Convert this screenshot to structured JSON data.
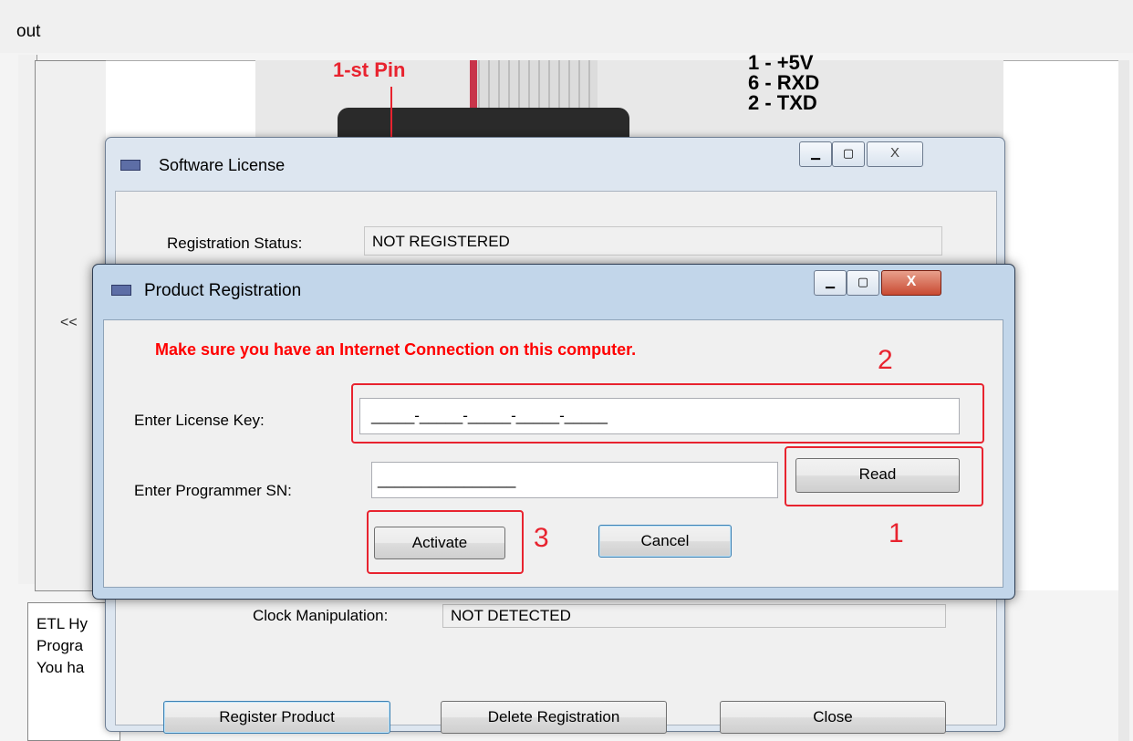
{
  "background_app": {
    "menu_text": "out",
    "image_labels": {
      "pin": "1-st Pin",
      "pinout": "1 - +5V\n6 - RXD\n2 - TXD"
    },
    "collapse_button": "<<",
    "log_lines": [
      "ETL Hy",
      "Progra",
      "You ha"
    ]
  },
  "license_window": {
    "title": "Software License",
    "registration_status_label": "Registration Status:",
    "registration_status_value": "NOT REGISTERED",
    "clock_label": "Clock Manipulation:",
    "clock_value": "NOT DETECTED",
    "register_button": "Register Product",
    "delete_button": "Delete Registration",
    "close_button": "Close",
    "caption": {
      "minimize": "▁",
      "maximize": "▢",
      "close": "X"
    }
  },
  "registration_dialog": {
    "title": "Product Registration",
    "warning": "Make sure you have an Internet Connection on this computer.",
    "license_key_label": "Enter License Key:",
    "license_key_value": "_____-_____-_____-_____-_____",
    "programmer_sn_label": "Enter Programmer SN:",
    "programmer_sn_value": "________________",
    "read_button": "Read",
    "activate_button": "Activate",
    "cancel_button": "Cancel",
    "caption": {
      "minimize": "▁",
      "maximize": "▢",
      "close": "X"
    }
  },
  "annotations": {
    "step_1": "1",
    "step_2": "2",
    "step_3": "3",
    "color": "#e8232f"
  }
}
